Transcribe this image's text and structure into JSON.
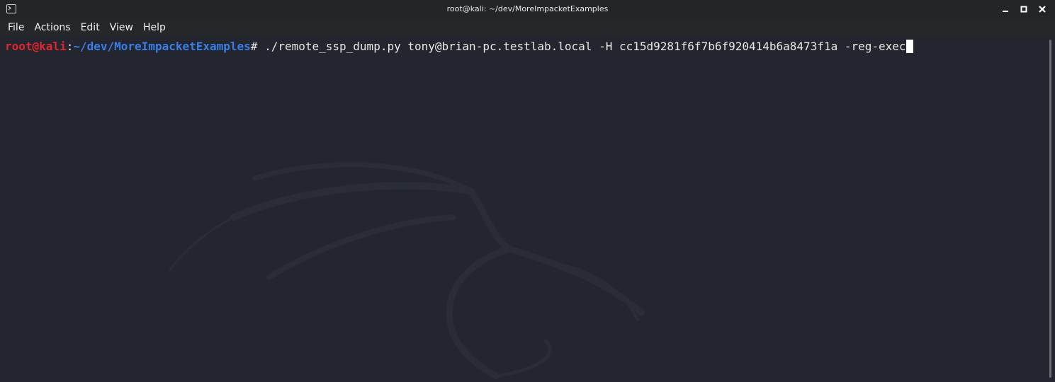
{
  "window": {
    "title": "root@kali: ~/dev/MoreImpacketExamples"
  },
  "menu": {
    "items": [
      "File",
      "Actions",
      "Edit",
      "View",
      "Help"
    ]
  },
  "terminal": {
    "prompt_user": "root@kali",
    "prompt_sep": ":",
    "prompt_path": "~/dev/MoreImpacketExamples",
    "prompt_symbol": "# ",
    "command": "./remote_ssp_dump.py tony@brian-pc.testlab.local -H cc15d9281f6f7b6f920414b6a8473f1a -reg-exec"
  },
  "colors": {
    "background": "#23262f",
    "prompt_user": "#e0262e",
    "prompt_path": "#3a7ee6",
    "text": "#e8e8e8"
  },
  "icons": {
    "app": "terminal-icon",
    "minimize": "minimize-icon",
    "maximize": "maximize-icon",
    "close": "close-icon"
  }
}
